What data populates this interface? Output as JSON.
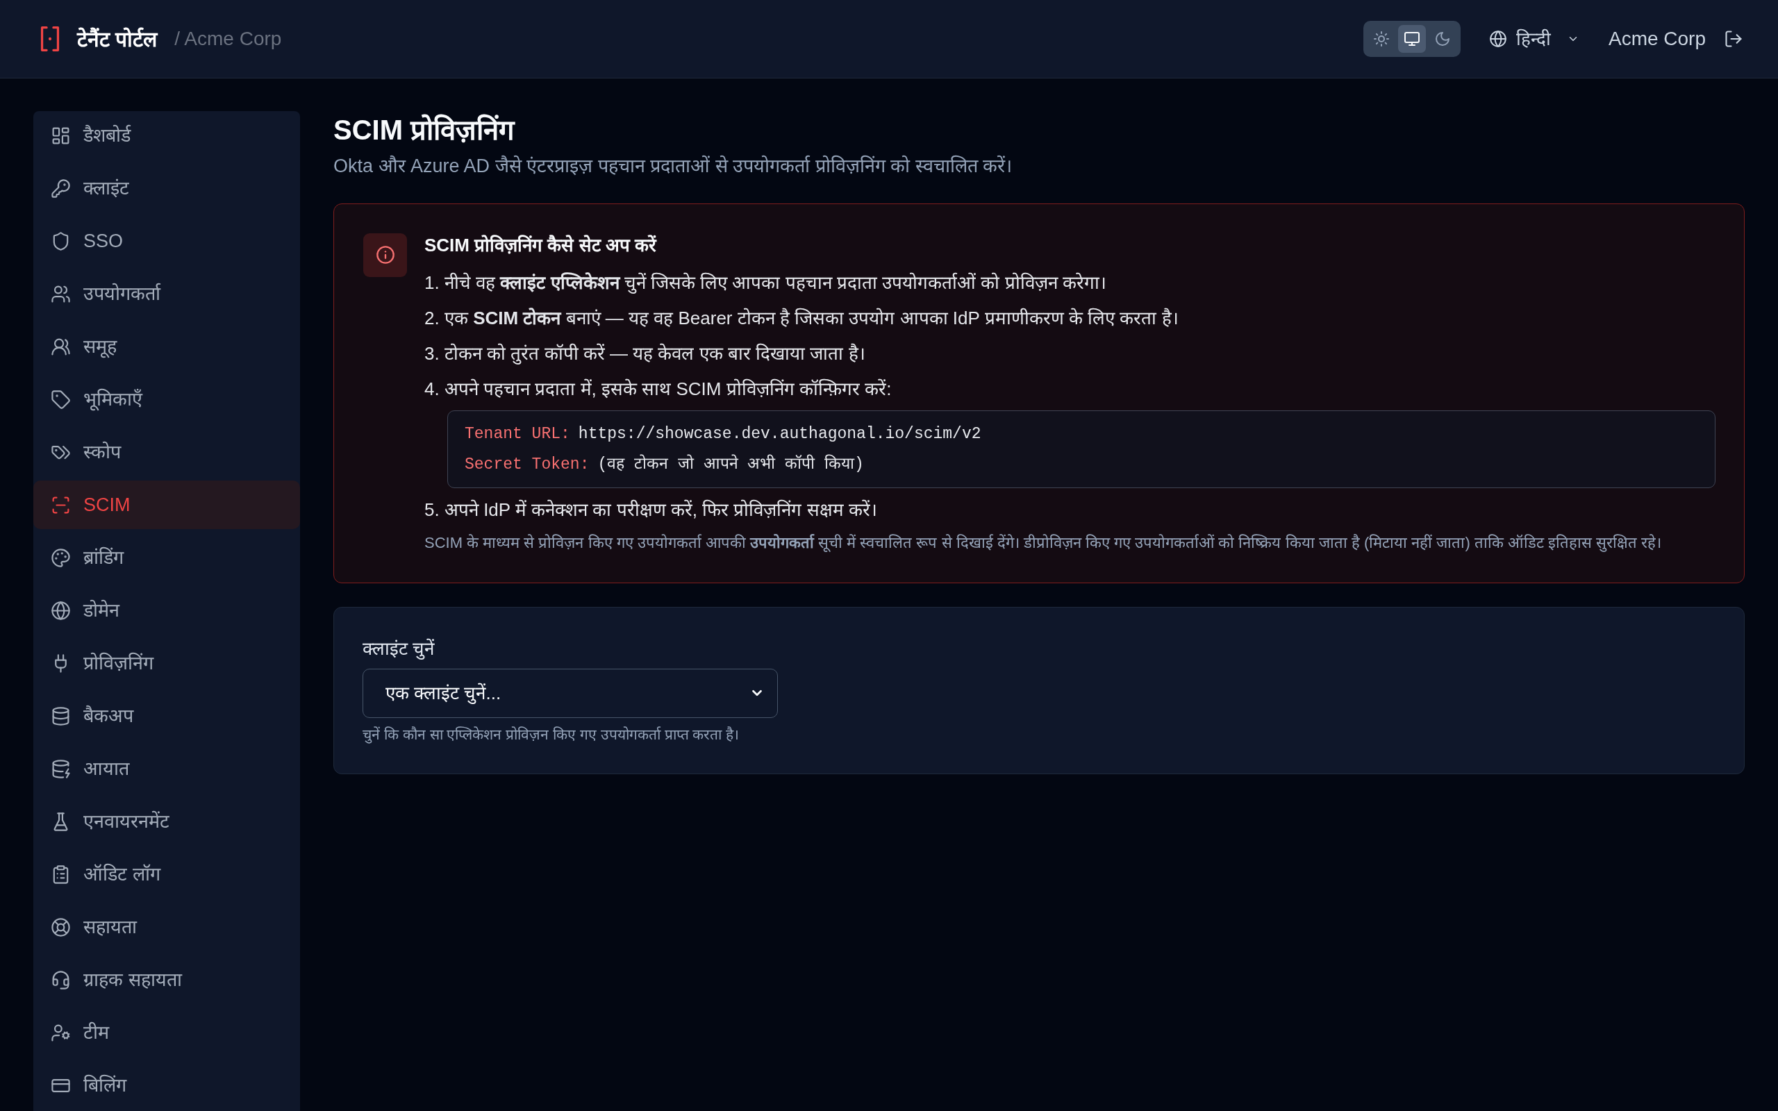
{
  "header": {
    "brand": "टेनैंट पोर्टल",
    "tenant": "/ Acme Corp",
    "theme_options": [
      {
        "selected": false
      },
      {
        "selected": true
      },
      {
        "selected": false
      }
    ],
    "language": "हिन्दी",
    "account": "Acme Corp"
  },
  "sidebar": {
    "items": [
      {
        "label": "डैशबोर्ड",
        "selected": false
      },
      {
        "label": "क्लाइंट",
        "selected": false
      },
      {
        "label": "SSO",
        "selected": false
      },
      {
        "label": "उपयोगकर्ता",
        "selected": false
      },
      {
        "label": "समूह",
        "selected": false
      },
      {
        "label": "भूमिकाएँ",
        "selected": false
      },
      {
        "label": "स्कोप",
        "selected": false
      },
      {
        "label": "SCIM",
        "selected": true
      },
      {
        "label": "ब्रांडिंग",
        "selected": false
      },
      {
        "label": "डोमेन",
        "selected": false
      },
      {
        "label": "प्रोविज़निंग",
        "selected": false
      },
      {
        "label": "बैकअप",
        "selected": false
      },
      {
        "label": "आयात",
        "selected": false
      },
      {
        "label": "एनवायरनमेंट",
        "selected": false
      },
      {
        "label": "ऑडिट लॉग",
        "selected": false
      },
      {
        "label": "सहायता",
        "selected": false
      },
      {
        "label": "ग्राहक सहायता",
        "selected": false
      },
      {
        "label": "टीम",
        "selected": false
      },
      {
        "label": "बिलिंग",
        "selected": false
      }
    ]
  },
  "page": {
    "title": "SCIM प्रोविज़निंग",
    "subtitle": "Okta और Azure AD जैसे एंटरप्राइज़ पहचान प्रदाताओं से उपयोगकर्ता प्रोविज़निंग को स्वचालित करें।"
  },
  "setup_guide": {
    "title": "SCIM प्रोविज़निंग कैसे सेट अप करें",
    "steps": [
      {
        "number": "1.",
        "text": "नीचे वह **क्लाइंट एप्लिकेशन** चुनें जिसके लिए आपका पहचान प्रदाता उपयोगकर्ताओं को प्रोविज़न करेगा।"
      },
      {
        "number": "2.",
        "text": "एक **SCIM टोकन** बनाएं — यह वह Bearer टोकन है जिसका उपयोग आपका IdP प्रमाणीकरण के लिए करता है।"
      },
      {
        "number": "3.",
        "text": "टोकन को तुरंत कॉपी करें — यह केवल एक बार दिखाया जाता है।"
      },
      {
        "number": "4.",
        "text": "अपने पहचान प्रदाता में, इसके साथ SCIM प्रोविज़निंग कॉन्फ़िगर करें:",
        "code": [
          {
            "label": "Tenant URL:",
            "value": "https://showcase.dev.authagonal.io/scim/v2"
          },
          {
            "label": "Secret Token:",
            "value": "(वह टोकन जो आपने अभी कॉपी किया)"
          }
        ]
      },
      {
        "number": "5.",
        "text": "अपने IdP में कनेक्शन का परीक्षण करें, फिर प्रोविज़निंग सक्षम करें।"
      }
    ],
    "note": "SCIM के माध्यम से प्रोविज़न किए गए उपयोगकर्ता आपकी **उपयोगकर्ता** सूची में स्वचालित रूप से दिखाई देंगे। डीप्रोविज़न किए गए उपयोगकर्ताओं को निष्क्रिय किया जाता है (मिटाया नहीं जाता) ताकि ऑडिट इतिहास सुरक्षित रहे।"
  },
  "client_picker": {
    "label": "क्लाइंट चुनें",
    "value": "एक क्लाइंट चुनें...",
    "help": "चुनें कि कौन सा एप्लिकेशन प्रोविज़न किए गए उपयोगकर्ता प्राप्त करता है।"
  }
}
